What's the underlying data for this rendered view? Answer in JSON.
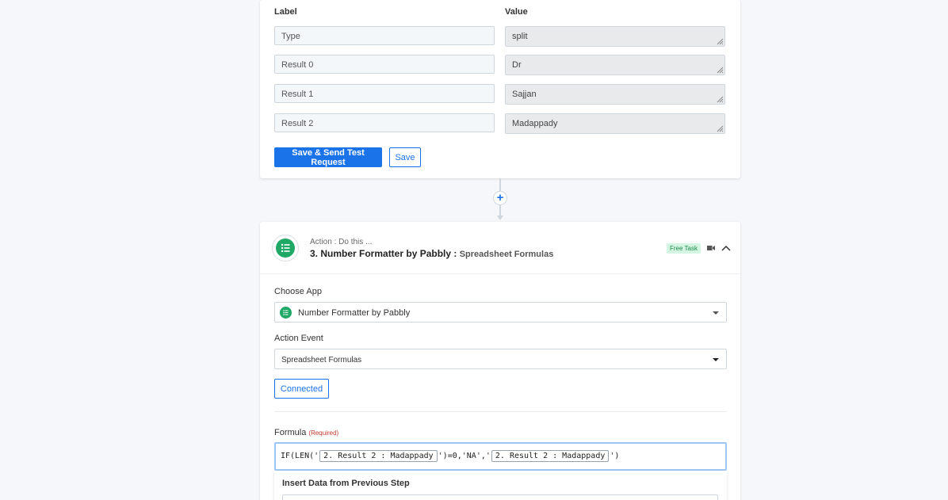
{
  "response_table": {
    "label_header": "Label",
    "value_header": "Value",
    "rows": [
      {
        "label": "Type",
        "value": "split"
      },
      {
        "label": "Result 0",
        "value": "Dr"
      },
      {
        "label": "Result 1",
        "value": "Sajjan"
      },
      {
        "label": "Result 2",
        "value": "Madappady"
      }
    ],
    "save_send_label": "Save & Send Test Request",
    "save_label": "Save"
  },
  "connector": {
    "plus_symbol": "+"
  },
  "action_step": {
    "subtitle": "Action : Do this ...",
    "title": "3. Number Formatter by Pabbly :",
    "event_name": "Spreadsheet Formulas",
    "badge": "Free Task",
    "badge_color": "#d4f5e2",
    "icons": [
      "video-icon",
      "chevron-up-icon"
    ],
    "choose_app_label": "Choose App",
    "app_selected": "Number Formatter by Pabbly",
    "action_event_label": "Action Event",
    "event_selected": "Spreadsheet Formulas",
    "connected_label": "Connected",
    "formula_label": "Formula",
    "required_text": "(Required)",
    "formula": {
      "prefix": "IF(LEN('",
      "pill1": "2. Result 2 : Madappady",
      "middle": "')=0,'NA','",
      "pill2": "2. Result 2 : Madappady",
      "suffix": "')"
    },
    "insert_title": "Insert Data from Previous Step"
  },
  "colors": {
    "primary": "#1a73e8",
    "app_green": "#1fa866",
    "background": "#f5f7fa"
  }
}
